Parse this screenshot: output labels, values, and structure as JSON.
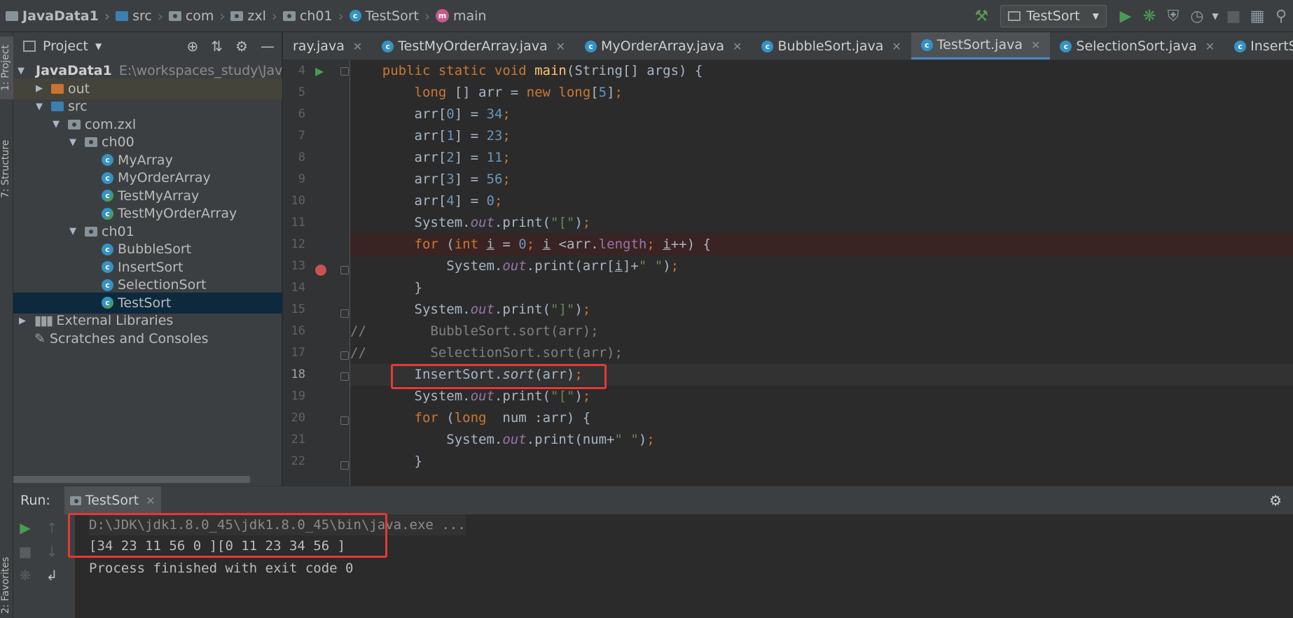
{
  "breadcrumb": [
    "JavaData1",
    "src",
    "com",
    "zxl",
    "ch01",
    "TestSort",
    "main"
  ],
  "run_config": "TestSort",
  "sidebar": {
    "project_tab": "1: Project",
    "structure_tab": "7: Structure",
    "favorites_tab": "2: Favorites"
  },
  "project": {
    "title": "Project",
    "tree": [
      {
        "label": "JavaData1",
        "path": "E:\\workspaces_study\\JavaDa",
        "depth": 0,
        "arrow": "▼",
        "icon": "folder"
      },
      {
        "label": "out",
        "depth": 1,
        "arrow": "▶",
        "icon": "folder-orange"
      },
      {
        "label": "src",
        "depth": 1,
        "arrow": "▼",
        "icon": "folder-blue"
      },
      {
        "label": "com.zxl",
        "depth": 2,
        "arrow": "▼",
        "icon": "package"
      },
      {
        "label": "ch00",
        "depth": 3,
        "arrow": "▼",
        "icon": "package"
      },
      {
        "label": "MyArray",
        "depth": 4,
        "arrow": "",
        "icon": "class"
      },
      {
        "label": "MyOrderArray",
        "depth": 4,
        "arrow": "",
        "icon": "class"
      },
      {
        "label": "TestMyArray",
        "depth": 4,
        "arrow": "",
        "icon": "class-run"
      },
      {
        "label": "TestMyOrderArray",
        "depth": 4,
        "arrow": "",
        "icon": "class-run"
      },
      {
        "label": "ch01",
        "depth": 3,
        "arrow": "▼",
        "icon": "package"
      },
      {
        "label": "BubbleSort",
        "depth": 4,
        "arrow": "",
        "icon": "class"
      },
      {
        "label": "InsertSort",
        "depth": 4,
        "arrow": "",
        "icon": "class"
      },
      {
        "label": "SelectionSort",
        "depth": 4,
        "arrow": "",
        "icon": "class"
      },
      {
        "label": "TestSort",
        "depth": 4,
        "arrow": "",
        "icon": "class-run"
      },
      {
        "label": "External Libraries",
        "depth": 0,
        "arrow": "▶",
        "icon": "libraries"
      },
      {
        "label": "Scratches and Consoles",
        "depth": 0,
        "arrow": "",
        "icon": "scratches"
      }
    ]
  },
  "tabs": [
    {
      "label": "ray.java"
    },
    {
      "label": "TestMyOrderArray.java"
    },
    {
      "label": "MyOrderArray.java"
    },
    {
      "label": "BubbleSort.java"
    },
    {
      "label": "TestSort.java"
    },
    {
      "label": "SelectionSort.java"
    },
    {
      "label": "InsertSort.java"
    }
  ],
  "editor": {
    "line_numbers": [
      "4",
      "5",
      "6",
      "7",
      "8",
      "9",
      "10",
      "11",
      "12",
      "13",
      "14",
      "15",
      "16",
      "17",
      "18",
      "19",
      "20",
      "21",
      "22"
    ]
  },
  "run": {
    "label": "Run:",
    "tab": "TestSort",
    "console": [
      "D:\\JDK\\jdk1.8.0_45\\jdk1.8.0_45\\bin\\java.exe ...",
      "[34 23 11 56 0 ][0 11 23 34 56 ]",
      "Process finished with exit code 0"
    ]
  },
  "colors": {
    "background": "#2b2b2b",
    "panel": "#3c3f41",
    "keyword": "#cc7832",
    "number": "#6897bb",
    "string": "#6a8759",
    "field": "#9876aa",
    "method": "#ffc66d",
    "highlight_box": "#e53935",
    "run_green": "#499c54",
    "breakpoint": "#c75450"
  }
}
